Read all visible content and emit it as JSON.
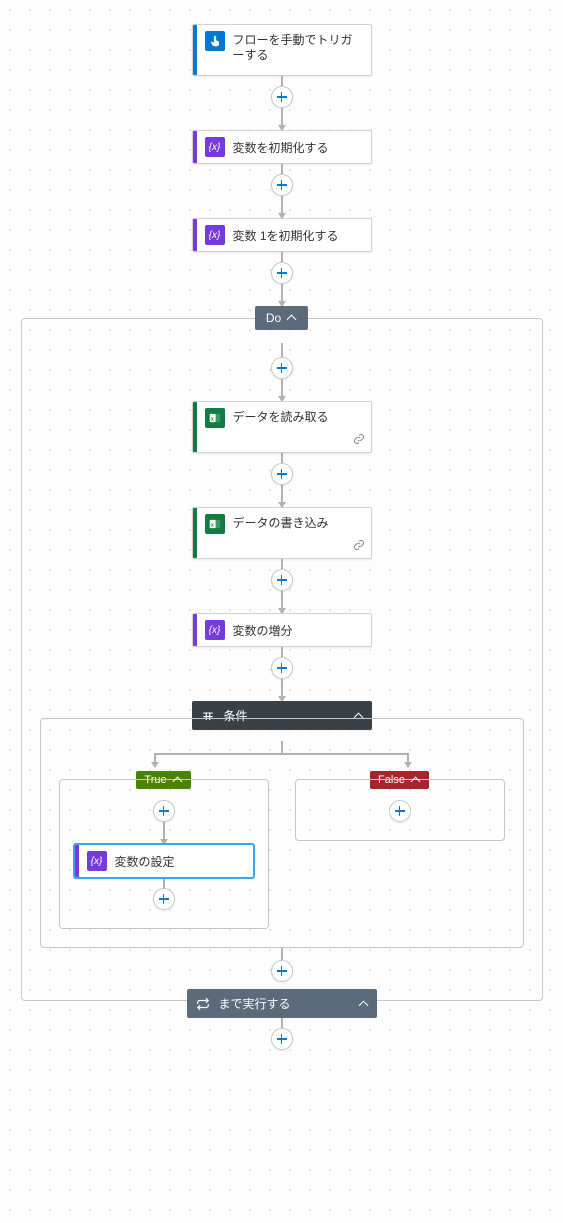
{
  "trigger": {
    "label": "フローを手動でトリガーする",
    "accent": "#0078d4",
    "icon": "touch-icon"
  },
  "steps": [
    {
      "label": "変数を初期化する",
      "accent": "#773adc",
      "icon": "variable-icon"
    },
    {
      "label": "変数 1を初期化する",
      "accent": "#773adc",
      "icon": "variable-icon"
    }
  ],
  "loop": {
    "header_label": "Do",
    "steps": [
      {
        "label": "データを読み取る",
        "accent": "#107c41",
        "icon": "excel-icon",
        "linked": true
      },
      {
        "label": "データの書き込み",
        "accent": "#107c41",
        "icon": "excel-icon",
        "linked": true
      },
      {
        "label": "変数の増分",
        "accent": "#773adc",
        "icon": "variable-icon"
      }
    ],
    "condition": {
      "label": "条件",
      "true_label": "True",
      "false_label": "False",
      "true_branch_step": {
        "label": "変数の設定",
        "accent": "#773adc",
        "icon": "variable-icon",
        "selected": true
      }
    },
    "until_label": "まで実行する"
  }
}
